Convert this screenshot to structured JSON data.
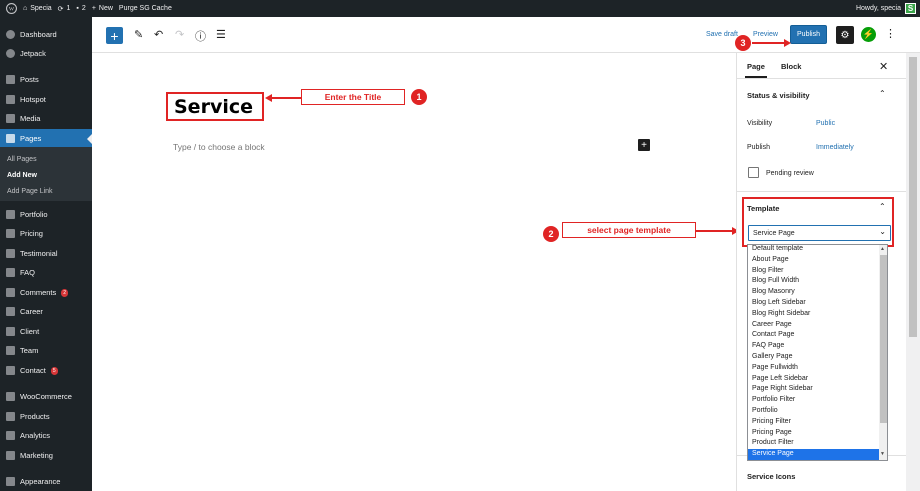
{
  "adminbar": {
    "site_name": "Specia",
    "updates_count": "1",
    "comments_count": "2",
    "new_label": "New",
    "purge_label": "Purge SG Cache",
    "howdy": "Howdy, specia",
    "avatar_letter": "S"
  },
  "sidebar": {
    "items": [
      {
        "label": "Dashboard"
      },
      {
        "label": "Jetpack"
      },
      {
        "label": "Posts"
      },
      {
        "label": "Hotspot"
      },
      {
        "label": "Media"
      },
      {
        "label": "Pages"
      },
      {
        "label": "Portfolio"
      },
      {
        "label": "Pricing"
      },
      {
        "label": "Testimonial"
      },
      {
        "label": "FAQ"
      },
      {
        "label": "Comments"
      },
      {
        "label": "Career"
      },
      {
        "label": "Client"
      },
      {
        "label": "Team"
      },
      {
        "label": "Contact"
      },
      {
        "label": "WooCommerce"
      },
      {
        "label": "Products"
      },
      {
        "label": "Analytics"
      },
      {
        "label": "Marketing"
      },
      {
        "label": "Appearance"
      }
    ],
    "submenu": [
      "All Pages",
      "Add New",
      "Add Page Link"
    ],
    "comments_badge": "2",
    "contact_badge": "5"
  },
  "header": {
    "save_draft": "Save draft",
    "preview": "Preview",
    "publish": "Publish"
  },
  "editor": {
    "title": "Service",
    "placeholder": "Type / to choose a block"
  },
  "callouts": {
    "one_label": "Enter the Title",
    "one_num": "1",
    "two_label": "select page template",
    "two_num": "2",
    "three_num": "3"
  },
  "panel": {
    "tab_page": "Page",
    "tab_block": "Block",
    "status_title": "Status & visibility",
    "visibility_label": "Visibility",
    "visibility_value": "Public",
    "publish_label": "Publish",
    "publish_value": "Immediately",
    "pending_review": "Pending review",
    "template_title": "Template",
    "template_selected": "Service Page",
    "service_icons": "Service Icons"
  },
  "dropdown": {
    "options": [
      "Default template",
      "About Page",
      "Blog Filter",
      "Blog Full Width",
      "Blog Masonry",
      "Blog Left Sidebar",
      "Blog Right Sidebar",
      "Career Page",
      "Contact Page",
      "FAQ Page",
      "Gallery Page",
      "Page Fullwidth",
      "Page Left Sidebar",
      "Page Right Sidebar",
      "Portfolio Filter",
      "Portfolio",
      "Pricing Filter",
      "Pricing Page",
      "Product Filter",
      "Service Page"
    ],
    "selected_index": 19
  },
  "colors": {
    "admin_dark": "#1d2327",
    "accent": "#2271b1",
    "annotation_red": "#e02424",
    "jetpack_green": "#069e08"
  }
}
